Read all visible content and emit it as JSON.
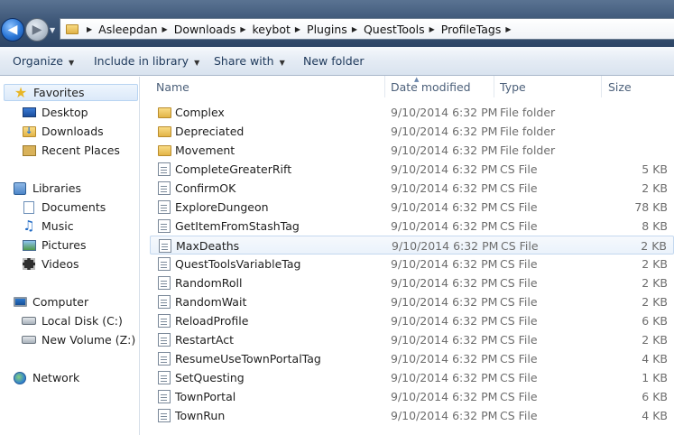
{
  "breadcrumb": [
    "Asleepdan",
    "Downloads",
    "keybot",
    "Plugins",
    "QuestTools",
    "ProfileTags"
  ],
  "toolbar": {
    "organize": "Organize",
    "include_in_library": "Include in library",
    "share_with": "Share with",
    "new_folder": "New folder"
  },
  "nav": {
    "favorites": "Favorites",
    "desktop": "Desktop",
    "downloads": "Downloads",
    "recent_places": "Recent Places",
    "libraries": "Libraries",
    "documents": "Documents",
    "music": "Music",
    "pictures": "Pictures",
    "videos": "Videos",
    "computer": "Computer",
    "local_disk": "Local Disk (C:)",
    "new_volume": "New Volume (Z:)",
    "network": "Network"
  },
  "columns": {
    "name": "Name",
    "date_modified": "Date modified",
    "type": "Type",
    "size": "Size"
  },
  "files": [
    {
      "name": "Complex",
      "date": "9/10/2014 6:32 PM",
      "type": "File folder",
      "size": "",
      "icon": "folder-icon"
    },
    {
      "name": "Depreciated",
      "date": "9/10/2014 6:32 PM",
      "type": "File folder",
      "size": "",
      "icon": "folder-icon"
    },
    {
      "name": "Movement",
      "date": "9/10/2014 6:32 PM",
      "type": "File folder",
      "size": "",
      "icon": "folder-icon"
    },
    {
      "name": "CompleteGreaterRift",
      "date": "9/10/2014 6:32 PM",
      "type": "CS File",
      "size": "5 KB",
      "icon": "cs-file-icon"
    },
    {
      "name": "ConfirmOK",
      "date": "9/10/2014 6:32 PM",
      "type": "CS File",
      "size": "2 KB",
      "icon": "cs-file-icon"
    },
    {
      "name": "ExploreDungeon",
      "date": "9/10/2014 6:32 PM",
      "type": "CS File",
      "size": "78 KB",
      "icon": "cs-file-icon"
    },
    {
      "name": "GetItemFromStashTag",
      "date": "9/10/2014 6:32 PM",
      "type": "CS File",
      "size": "8 KB",
      "icon": "cs-file-icon"
    },
    {
      "name": "MaxDeaths",
      "date": "9/10/2014 6:32 PM",
      "type": "CS File",
      "size": "2 KB",
      "icon": "cs-file-icon"
    },
    {
      "name": "QuestToolsVariableTag",
      "date": "9/10/2014 6:32 PM",
      "type": "CS File",
      "size": "2 KB",
      "icon": "cs-file-icon"
    },
    {
      "name": "RandomRoll",
      "date": "9/10/2014 6:32 PM",
      "type": "CS File",
      "size": "2 KB",
      "icon": "cs-file-icon"
    },
    {
      "name": "RandomWait",
      "date": "9/10/2014 6:32 PM",
      "type": "CS File",
      "size": "2 KB",
      "icon": "cs-file-icon"
    },
    {
      "name": "ReloadProfile",
      "date": "9/10/2014 6:32 PM",
      "type": "CS File",
      "size": "6 KB",
      "icon": "cs-file-icon"
    },
    {
      "name": "RestartAct",
      "date": "9/10/2014 6:32 PM",
      "type": "CS File",
      "size": "2 KB",
      "icon": "cs-file-icon"
    },
    {
      "name": "ResumeUseTownPortalTag",
      "date": "9/10/2014 6:32 PM",
      "type": "CS File",
      "size": "4 KB",
      "icon": "cs-file-icon"
    },
    {
      "name": "SetQuesting",
      "date": "9/10/2014 6:32 PM",
      "type": "CS File",
      "size": "1 KB",
      "icon": "cs-file-icon"
    },
    {
      "name": "TownPortal",
      "date": "9/10/2014 6:32 PM",
      "type": "CS File",
      "size": "6 KB",
      "icon": "cs-file-icon"
    },
    {
      "name": "TownRun",
      "date": "9/10/2014 6:32 PM",
      "type": "CS File",
      "size": "4 KB",
      "icon": "cs-file-icon"
    }
  ],
  "hovered_file": "MaxDeaths"
}
